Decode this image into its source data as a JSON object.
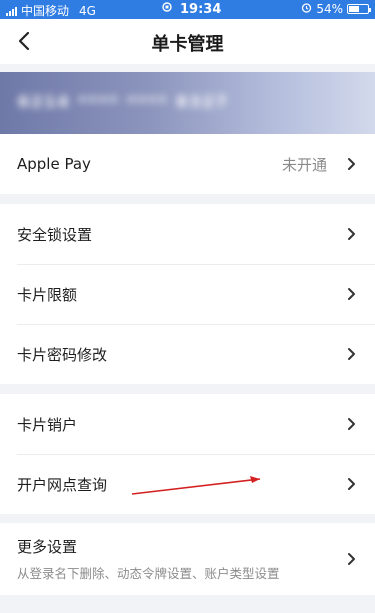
{
  "status_bar": {
    "carrier": "中国移动",
    "network": "4G",
    "time": "19:34",
    "battery": "54%",
    "battery_level": 0.54
  },
  "nav": {
    "title": "单卡管理",
    "back_icon": "chevron-left-icon"
  },
  "card": {
    "masked_number": "6214 **** **** 8327"
  },
  "apple_pay": {
    "label": "Apple Pay",
    "value": "未开通"
  },
  "security_group": [
    {
      "id": "security-lock",
      "label": "安全锁设置"
    },
    {
      "id": "card-limit",
      "label": "卡片限额"
    },
    {
      "id": "card-password",
      "label": "卡片密码修改"
    }
  ],
  "account_group": [
    {
      "id": "card-cancel",
      "label": "卡片销户"
    },
    {
      "id": "branch-query",
      "label": "开户网点查询"
    }
  ],
  "more": {
    "label": "更多设置",
    "sub": "从登录名下删除、动态令牌设置、账户类型设置"
  },
  "colors": {
    "status_bar": "#2f7ce3",
    "page_bg": "#f2f3f7",
    "annotation_arrow": "#d42020"
  }
}
